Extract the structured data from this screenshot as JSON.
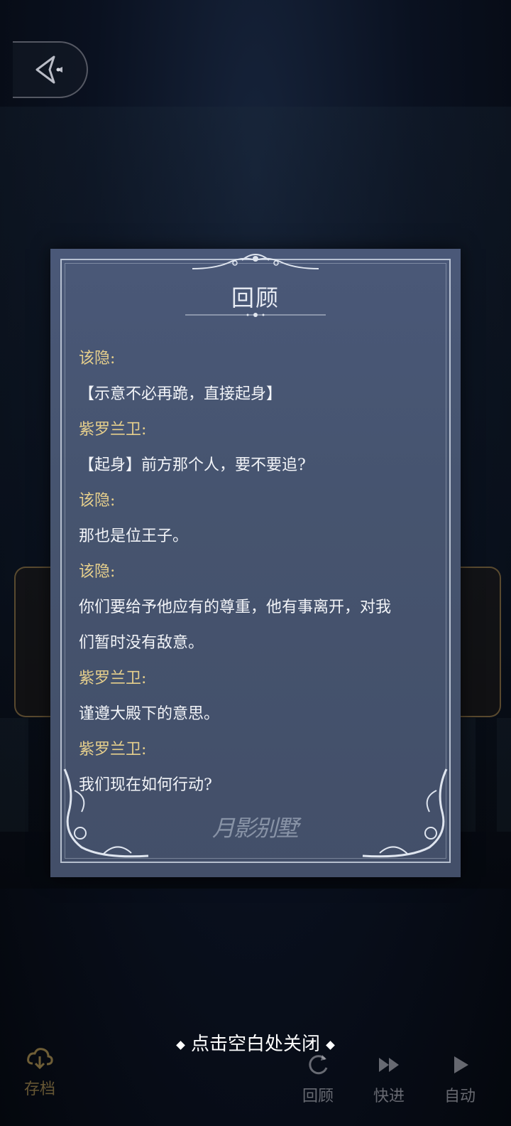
{
  "panel": {
    "title": "回顾",
    "watermark": "月影别墅",
    "entries": [
      {
        "kind": "speaker",
        "text": "该隐:"
      },
      {
        "kind": "line",
        "text": "【示意不必再跪，直接起身】"
      },
      {
        "kind": "speaker",
        "text": "紫罗兰卫:"
      },
      {
        "kind": "line",
        "text": "【起身】前方那个人，要不要追?"
      },
      {
        "kind": "speaker",
        "text": "该隐:"
      },
      {
        "kind": "line",
        "text": "那也是位王子。"
      },
      {
        "kind": "speaker",
        "text": "该隐:"
      },
      {
        "kind": "line",
        "text": "你们要给予他应有的尊重，他有事离开，对我"
      },
      {
        "kind": "line",
        "text": "们暂时没有敌意。"
      },
      {
        "kind": "speaker",
        "text": "紫罗兰卫:"
      },
      {
        "kind": "line",
        "text": "谨遵大殿下的意思。"
      },
      {
        "kind": "speaker",
        "text": "紫罗兰卫:"
      },
      {
        "kind": "line",
        "text": "我们现在如何行动?"
      }
    ]
  },
  "hint": {
    "close_text": "点击空白处关闭"
  },
  "toolbar": {
    "save_label": "存档",
    "review_label": "回顾",
    "fast_forward_label": "快进",
    "auto_label": "自动"
  },
  "colors": {
    "speaker": "#e6cf8c",
    "dialog_text": "#f2f4f8",
    "panel_bg": "#46546f"
  },
  "icons": {
    "back": "back-arrow-icon",
    "save": "cloud-download-icon",
    "review": "review-icon",
    "fast_forward": "fast-forward-icon",
    "auto": "play-icon"
  }
}
